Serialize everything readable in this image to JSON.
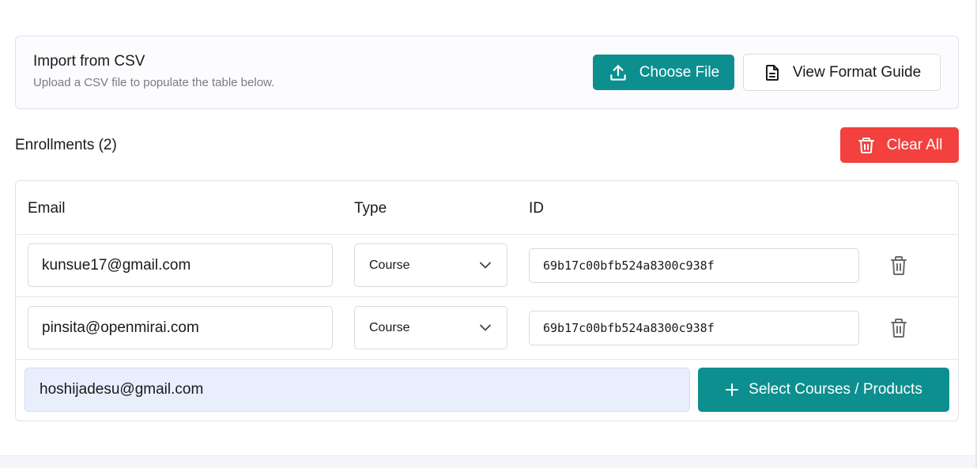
{
  "import": {
    "title": "Import from CSV",
    "subtitle": "Upload a CSV file to populate the table below.",
    "choose_file_label": "Choose File",
    "format_guide_label": "View Format Guide"
  },
  "enrollments": {
    "title": "Enrollments (2)",
    "clear_all_label": "Clear All"
  },
  "table": {
    "headers": {
      "email": "Email",
      "type": "Type",
      "id": "ID"
    },
    "rows": [
      {
        "email": "kunsue17@gmail.com",
        "type": "Course",
        "id": "69b17c00bfb524a8300c938f"
      },
      {
        "email": "pinsita@openmirai.com",
        "type": "Course",
        "id": "69b17c00bfb524a8300c938f"
      }
    ],
    "new_entry": {
      "email_value": "hoshijadesu@gmail.com",
      "select_button_label": "Select Courses / Products"
    }
  },
  "colors": {
    "teal": "#0d8f8f",
    "red": "#f2413e",
    "input_highlight": "#e8eefc"
  },
  "icons": {
    "choose_file": "upload-icon",
    "format_guide": "document-icon",
    "clear_all": "trash-icon",
    "row_delete": "trash-icon",
    "type_select": "chevron-down-icon",
    "select_products": "plus-icon"
  }
}
